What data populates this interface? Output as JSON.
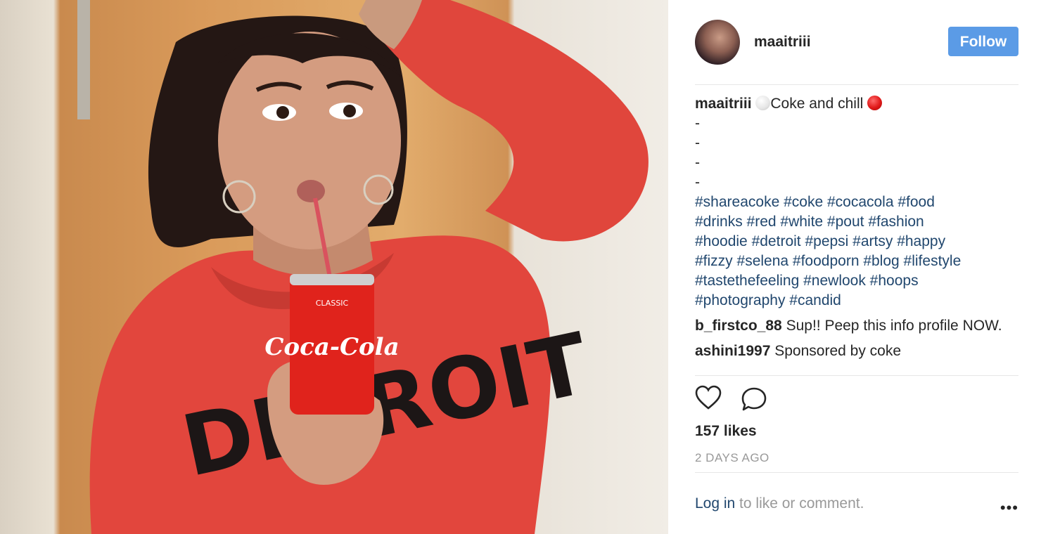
{
  "post": {
    "author": {
      "username": "maaitriii",
      "follow_label": "Follow"
    },
    "caption": {
      "username": "maaitriii",
      "text": "Coke and chill",
      "dashes": [
        "-",
        "-",
        "-",
        "-"
      ],
      "hashtag_lines": [
        "#shareacoke #coke #cocacola #food",
        "#drinks #red #white #pout #fashion",
        "#hoodie #detroit #pepsi #artsy #happy",
        "#fizzy #selena #foodporn #blog #lifestyle",
        "#tastethefeeling #newlook #hoops",
        "#photography #candid"
      ]
    },
    "comments": [
      {
        "username": "b_firstco_88",
        "text": "Sup!! Peep this info profile NOW."
      },
      {
        "username": "ashini1997",
        "text": "Sponsored by coke"
      }
    ],
    "likes": "157 likes",
    "timestamp": "2 DAYS AGO",
    "login_link": "Log in",
    "login_rest": " to like or comment.",
    "more_label": "•••"
  },
  "photo": {
    "can_brand": "Coca-Cola",
    "can_label": "CLASSIC",
    "hoodie_text": "DETROIT"
  },
  "colors": {
    "follow_button": "#5b9be6",
    "hashtag": "#21476e",
    "hoodie": "#e2463d"
  },
  "icons": [
    "heart-icon",
    "comment-bubble-icon",
    "more-options-icon"
  ]
}
